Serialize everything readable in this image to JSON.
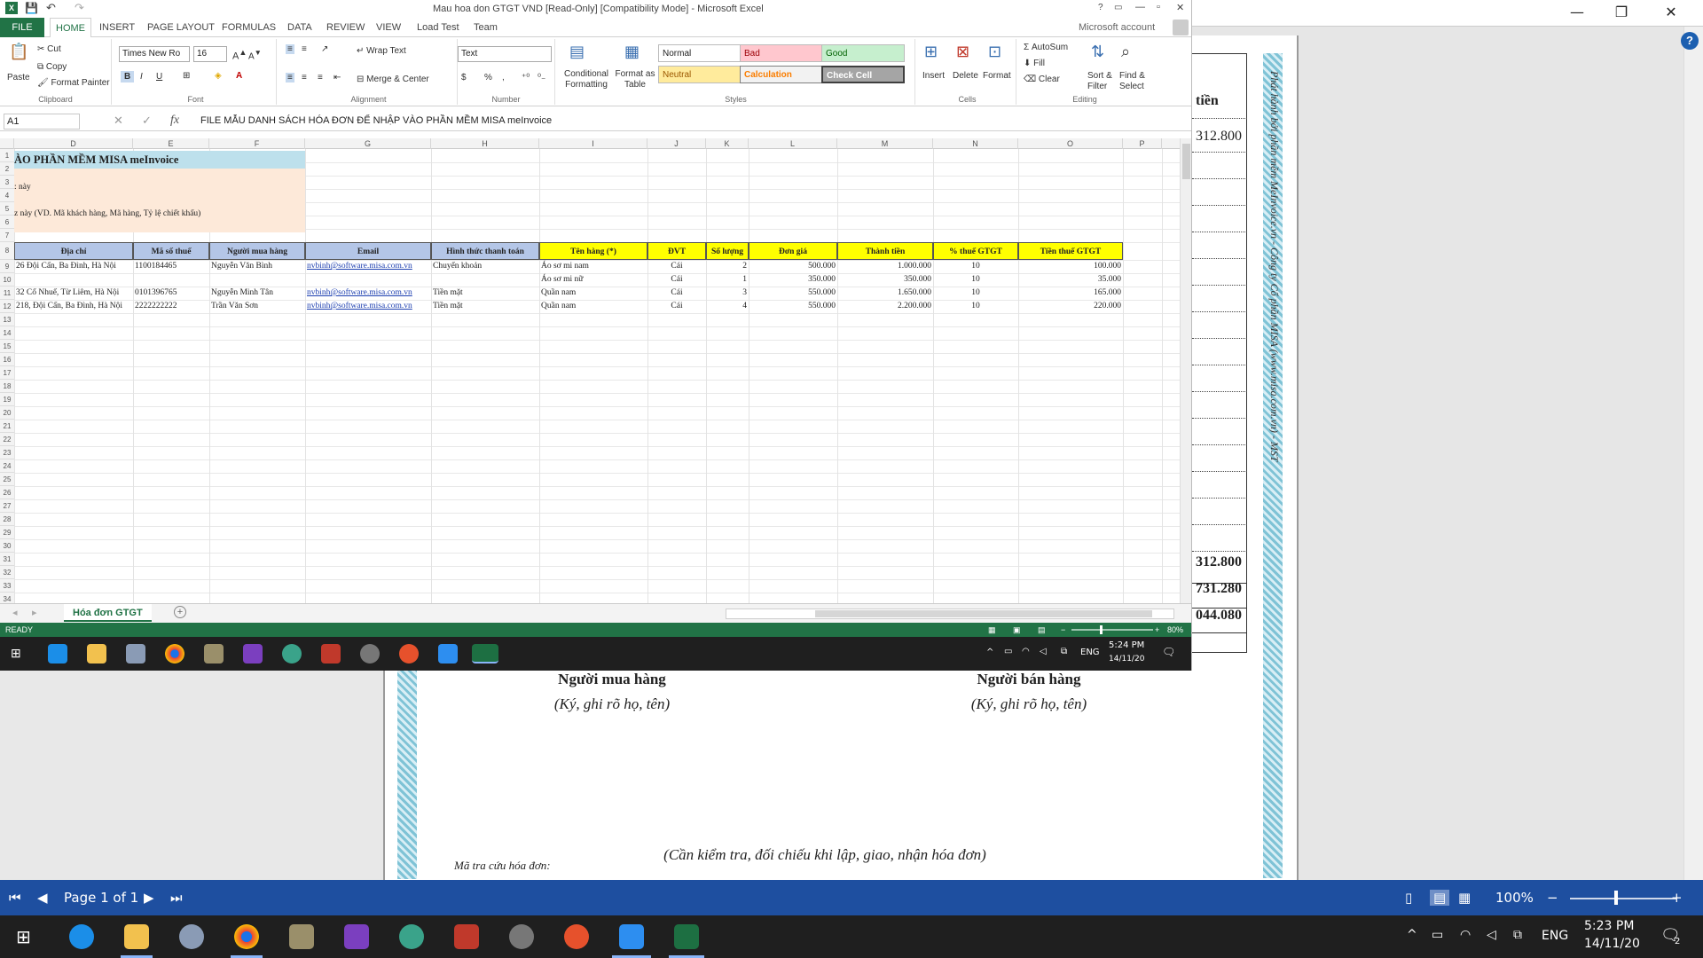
{
  "excel": {
    "title": "Mau hoa don GTGT VND [Read-Only] [Compatibility Mode] - Microsoft Excel",
    "account": "Microsoft account",
    "tabs": [
      "FILE",
      "HOME",
      "INSERT",
      "PAGE LAYOUT",
      "FORMULAS",
      "DATA",
      "REVIEW",
      "VIEW",
      "Load Test",
      "Team"
    ],
    "clipboard": {
      "paste": "Paste",
      "cut": "Cut",
      "copy": "Copy",
      "format_painter": "Format Painter",
      "label": "Clipboard"
    },
    "font": {
      "name": "Times New Ro",
      "size": "16",
      "label": "Font",
      "bold": "B",
      "italic": "I",
      "underline": "U"
    },
    "alignment": {
      "wrap": "Wrap Text",
      "merge": "Merge & Center",
      "label": "Alignment"
    },
    "number": {
      "format": "Text",
      "currency": "$",
      "percent": "%",
      "comma": ",",
      "label": "Number"
    },
    "styles": {
      "conditional": "Conditional Formatting",
      "format_table": "Format as Table",
      "normal": "Normal",
      "bad": "Bad",
      "good": "Good",
      "neutral": "Neutral",
      "calculation": "Calculation",
      "check": "Check Cell",
      "label": "Styles"
    },
    "cells": {
      "insert": "Insert",
      "delete": "Delete",
      "format": "Format",
      "label": "Cells"
    },
    "editing": {
      "autosum": "AutoSum",
      "fill": "Fill",
      "clear": "Clear",
      "sort": "Sort & Filter",
      "find": "Find & Select",
      "label": "Editing"
    },
    "namebox": "A1",
    "fx": "fx",
    "formula": "FILE MẪU DANH SÁCH HÓA ĐƠN ĐỂ NHẬP VÀO PHẦN MỀM MISA meInvoice",
    "columns": [
      "D",
      "E",
      "F",
      "G",
      "H",
      "I",
      "J",
      "K",
      "L",
      "M",
      "N",
      "O",
      "P"
    ],
    "title_cell": "ÀO PHẦN MỀM MISA meInvoice",
    "note1": ": này",
    "note2": "z này (VD. Mã khách hàng, Mã hàng, Tỷ lệ chiết khấu)",
    "headers": [
      "Địa chỉ",
      "Mã số thuế",
      "Người mua hàng",
      "Email",
      "Hình thức thanh toán",
      "Tên hàng (*)",
      "ĐVT",
      "Số lượng",
      "Đơn giá",
      "Thành tiền",
      "% thuế GTGT",
      "Tiền thuế GTGT"
    ],
    "rows": [
      {
        "row": "9",
        "addr": "26 Đội Cấn, Ba Đình, Hà Nội",
        "tax": "1100184465",
        "buyer": "Nguyễn Văn Bình",
        "email": "nvbinh@software.misa.com.vn",
        "pay": "Chuyển khoản",
        "item": "Áo sơ mi nam",
        "unit": "Cái",
        "qty": "2",
        "price": "500.000",
        "amount": "1.000.000",
        "vat": "10",
        "vatamt": "100.000"
      },
      {
        "row": "10",
        "addr": "",
        "tax": "",
        "buyer": "",
        "email": "",
        "pay": "",
        "item": "Áo sơ mi nữ",
        "unit": "Cái",
        "qty": "1",
        "price": "350.000",
        "amount": "350.000",
        "vat": "10",
        "vatamt": "35.000"
      },
      {
        "row": "11",
        "addr": "32 Cổ Nhuế, Từ Liêm, Hà Nội",
        "tax": "0101396765",
        "buyer": "Nguyễn Minh Tân",
        "email": "nvbinh@software.misa.com.vn",
        "pay": "Tiền mặt",
        "item": "Quần nam",
        "unit": "Cái",
        "qty": "3",
        "price": "550.000",
        "amount": "1.650.000",
        "vat": "10",
        "vatamt": "165.000"
      },
      {
        "row": "12",
        "addr": "218, Đội Cấn, Ba Đình, Hà Nội",
        "tax": "2222222222",
        "buyer": "Trần Văn Sơn",
        "email": "nvbinh@software.misa.com.vn",
        "pay": "Tiền mặt",
        "item": "Quần nam",
        "unit": "Cái",
        "qty": "4",
        "price": "550.000",
        "amount": "2.200.000",
        "vat": "10",
        "vatamt": "220.000"
      }
    ],
    "row_numbers": [
      "1",
      "2",
      "3",
      "4",
      "5",
      "6",
      "7",
      "8",
      "9",
      "10",
      "11",
      "12",
      "13",
      "14",
      "15",
      "16",
      "17",
      "18",
      "19",
      "20",
      "21",
      "22",
      "23",
      "24",
      "25",
      "26",
      "27",
      "28",
      "29",
      "30",
      "31",
      "32",
      "33",
      "34"
    ],
    "sheet_tab": "Hóa đơn GTGT",
    "status": "READY",
    "zoom": "80%",
    "clock_time": "5:24 PM",
    "clock_date": "14/11/20",
    "lang": "ENG"
  },
  "viewer": {
    "col_header": "tiền",
    "top_value": "312.800",
    "totals": [
      "312.800",
      "731.280",
      "044.080"
    ],
    "side_text": "Phát hành bởi phần mềm MeInvoice.vn - Công ty Cổ phần MISA (www.misa.com.vn) - MST",
    "buyer_sign": "Người mua hàng",
    "buyer_note": "(Ký, ghi rõ họ, tên)",
    "seller_sign": "Người bán hàng",
    "seller_note": "(Ký, ghi rõ họ, tên)",
    "check_note": "(Cần kiểm tra, đối chiếu khi lập, giao, nhận hóa đơn)",
    "lookup_label": "Mã tra cứu hóa đơn:",
    "page_label": "Page 1 of 1",
    "zoom": "100%",
    "help": "?"
  },
  "taskbar": {
    "time": "5:23 PM",
    "date": "14/11/20",
    "lang": "ENG",
    "notif": "2"
  }
}
